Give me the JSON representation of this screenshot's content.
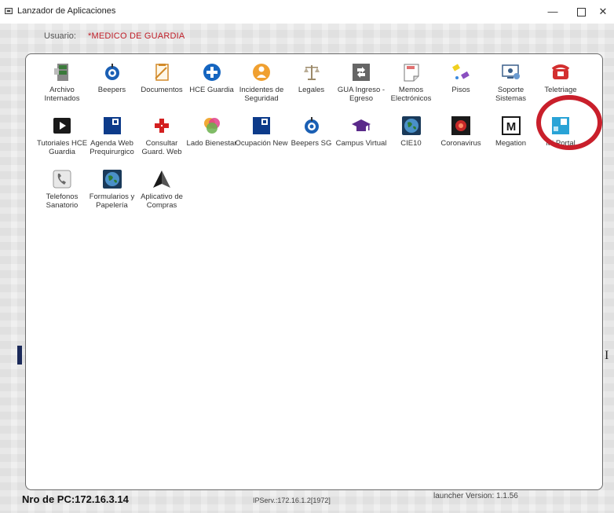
{
  "window": {
    "title": "Lanzador de Aplicaciones",
    "minimize": "—",
    "close": "✕"
  },
  "user": {
    "label": "Usuario:",
    "value": "*MEDICO DE GUARDIA"
  },
  "apps": [
    {
      "label": "Archivo Internados",
      "icon": "archive-cabinet-icon",
      "color": "#3a7a3a"
    },
    {
      "label": "Beepers",
      "icon": "beeper-icon",
      "color": "#1a5fb4"
    },
    {
      "label": "Documentos",
      "icon": "documents-icon",
      "color": "#d28a2a"
    },
    {
      "label": "HCE Guardia",
      "icon": "plus-cross-icon",
      "color": "#1565c0"
    },
    {
      "label": "Incidentes de Seguridad",
      "icon": "person-alert-icon",
      "color": "#f0a030"
    },
    {
      "label": "Legales",
      "icon": "scales-icon",
      "color": "#9c8a6a"
    },
    {
      "label": "GUA Ingreso - Egreso",
      "icon": "swap-arrows-icon",
      "color": "#666666"
    },
    {
      "label": "Memos Electrónicos",
      "icon": "memo-icon",
      "color": "#e07070"
    },
    {
      "label": "Pisos",
      "icon": "floor-tags-icon",
      "color": "#8a4fc0"
    },
    {
      "label": "Soporte Sistemas",
      "icon": "support-monitor-icon",
      "color": "#3a5f8a"
    },
    {
      "label": "Teletriage",
      "icon": "telephone-icon",
      "color": "#d32f2f"
    },
    {
      "label": "Tutoriales HCE Guardia",
      "icon": "video-play-icon",
      "color": "#1a1a1a"
    },
    {
      "label": "Agenda Web Prequirurgico",
      "icon": "agenda-logo-icon",
      "color": "#0d3b8a"
    },
    {
      "label": "Consultar Guard. Web",
      "icon": "medical-cross-icon",
      "color": "#d32020"
    },
    {
      "label": "Lado Bienestar",
      "icon": "wellbeing-circles-icon",
      "color": "#e0408a"
    },
    {
      "label": "Ocupación New",
      "icon": "occupancy-logo-icon",
      "color": "#0d3b8a"
    },
    {
      "label": "Beepers SG",
      "icon": "beeper-icon",
      "color": "#1a5fb4"
    },
    {
      "label": "Campus Virtual",
      "icon": "graduation-cap-icon",
      "color": "#5a2a8a"
    },
    {
      "label": "CIE10",
      "icon": "globe-icon",
      "color": "#2e7d32"
    },
    {
      "label": "Coronavirus",
      "icon": "virus-icon",
      "color": "#c62828"
    },
    {
      "label": "Megation",
      "icon": "m-box-icon",
      "color": "#1a1a1a"
    },
    {
      "label": "Mi Portal",
      "icon": "portal-logo-icon",
      "color": "#29a3d6"
    },
    {
      "label": "Telefonos Sanatorio",
      "icon": "phone-handset-icon",
      "color": "#6a6a6a"
    },
    {
      "label": "Formularios y Papelería",
      "icon": "globe-icon",
      "color": "#2e7d32"
    },
    {
      "label": "Aplicativo de Compras",
      "icon": "pyramid-icon",
      "color": "#1a1a1a"
    }
  ],
  "footer": {
    "pc": "Nro de PC:172.16.3.14",
    "ip": "IPServ.:172.16.1.2[1972]",
    "version": "launcher Version: 1.1.56"
  }
}
